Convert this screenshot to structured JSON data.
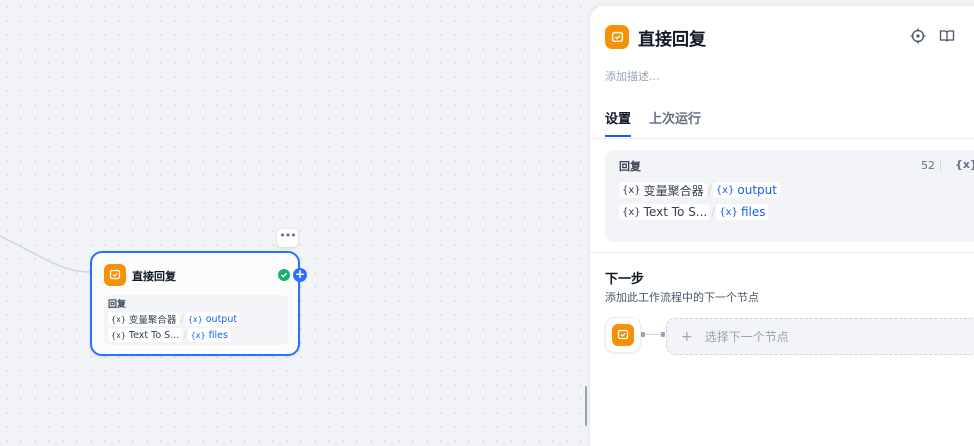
{
  "canvas": {
    "node": {
      "title": "直接回复",
      "more_label": "•••",
      "plus_label": "+",
      "reply_label": "回复",
      "variables": [
        {
          "source": "变量聚合器",
          "field": "output"
        },
        {
          "source": "Text To S...",
          "field": "files"
        }
      ]
    }
  },
  "var_prefix": "{x}",
  "path_separator": "/",
  "panel": {
    "title": "直接回复",
    "description_placeholder": "添加描述...",
    "tabs": [
      {
        "label": "设置",
        "active": true
      },
      {
        "label": "上次运行",
        "active": false
      }
    ],
    "reply": {
      "label": "回复",
      "count": "52",
      "var_button": "{x}",
      "variables": [
        {
          "source": "变量聚合器",
          "field": "output"
        },
        {
          "source": "Text To S...",
          "field": "files"
        }
      ]
    },
    "next_step": {
      "title": "下一步",
      "description": "添加此工作流程中的下一个节点",
      "select_placeholder": "选择下一个节点",
      "plus_label": "+"
    }
  },
  "colors": {
    "accent": "#2970ff",
    "node_icon": "#f79009",
    "success": "#17b26a",
    "variable_text": "#155eef"
  },
  "icons": [
    "reply-icon",
    "check-icon",
    "plus-icon",
    "locate-icon",
    "book-icon",
    "more-icon"
  ]
}
